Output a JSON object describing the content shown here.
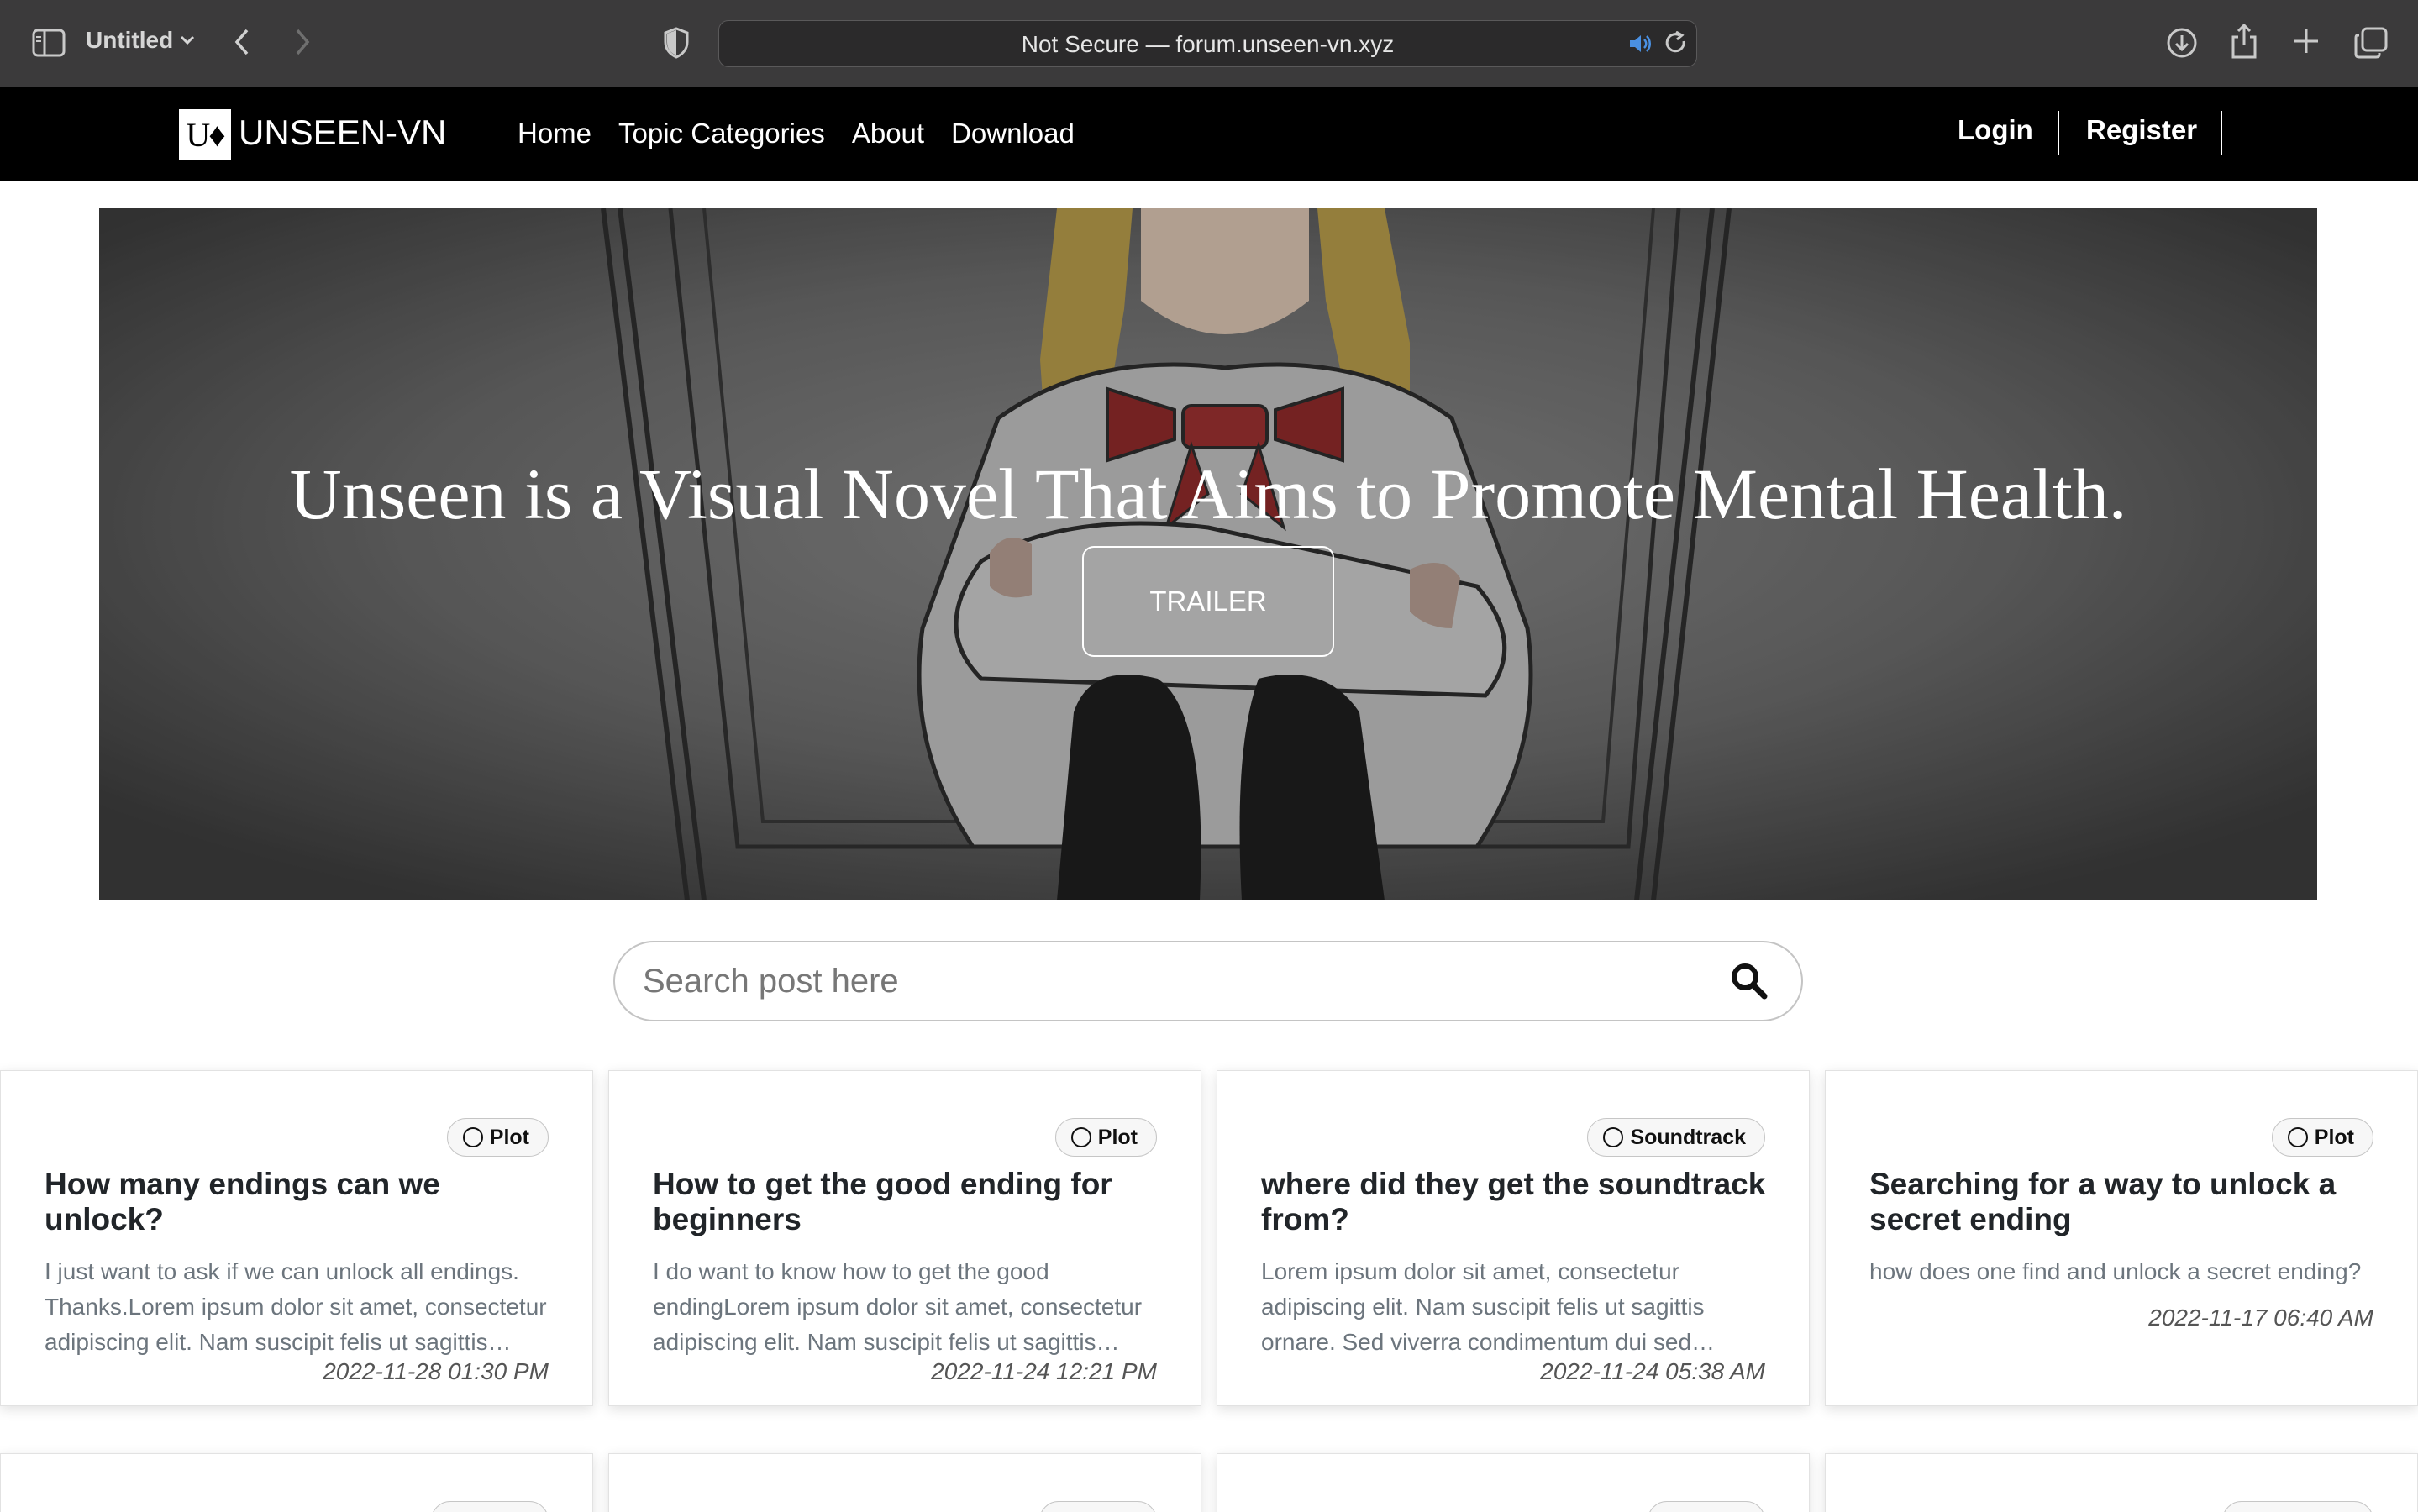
{
  "browser": {
    "tab_title": "Untitled",
    "url_text": "Not Secure — forum.unseen-vn.xyz"
  },
  "site": {
    "logo_mark": "U♦",
    "brand": "UNSEEN-VN",
    "nav": [
      "Home",
      "Topic Categories",
      "About",
      "Download"
    ],
    "login": "Login",
    "register": "Register"
  },
  "hero": {
    "title": "Unseen is a Visual Novel That Aims to Promote Mental Health.",
    "button": "TRAILER"
  },
  "search": {
    "placeholder": "Search post here"
  },
  "posts": [
    {
      "tag": "Plot",
      "title": "How many endings can we unlock?",
      "excerpt": "I just want to ask if we can unlock all endings. Thanks.Lorem ipsum dolor sit amet, consectetur adipiscing elit. Nam suscipit felis ut sagittis…",
      "date": "2022-11-28 01:30 PM"
    },
    {
      "tag": "Plot",
      "title": "How to get the good ending for beginners",
      "excerpt": "I do want to know how to get the good endingLorem ipsum dolor sit amet, consectetur adipiscing elit. Nam suscipit felis ut sagittis…",
      "date": "2022-11-24 12:21 PM"
    },
    {
      "tag": "Soundtrack",
      "title": "where did they get the soundtrack from?",
      "excerpt": "Lorem ipsum dolor sit amet, consectetur adipiscing elit. Nam suscipit felis ut sagittis ornare. Sed viverra condimentum dui sed…",
      "date": "2022-11-24 05:38 AM"
    },
    {
      "tag": "Plot",
      "title": "Searching for a way to unlock a secret ending",
      "excerpt": "how does one find and unlock a secret ending?",
      "date": "2022-11-17 06:40 AM"
    }
  ]
}
